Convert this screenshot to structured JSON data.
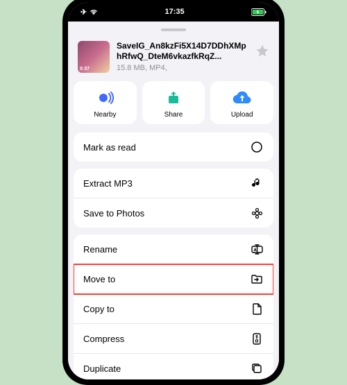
{
  "status": {
    "time": "17:35"
  },
  "file": {
    "name": "SaveIG_An8kzFi5X14D7DDhXMphRfwQ_DteM6vkazfkRqZ...",
    "meta": "15.8 MB, MP4,",
    "duration": "0:37"
  },
  "actions": {
    "nearby": "Nearby",
    "share": "Share",
    "upload": "Upload"
  },
  "menu": {
    "mark_read": "Mark as read",
    "extract_mp3": "Extract MP3",
    "save_photos": "Save to Photos",
    "rename": "Rename",
    "move_to": "Move to",
    "copy_to": "Copy to",
    "compress": "Compress",
    "duplicate": "Duplicate"
  }
}
